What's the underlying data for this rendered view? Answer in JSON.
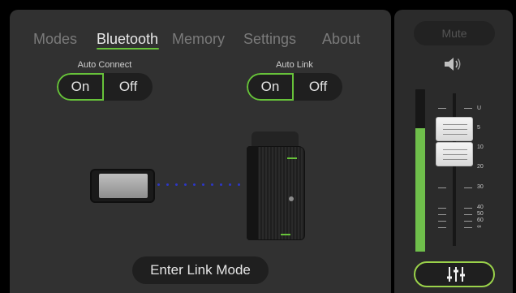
{
  "tabs": [
    "Modes",
    "Bluetooth",
    "Memory",
    "Settings",
    "About"
  ],
  "active_tab": "Bluetooth",
  "auto_connect": {
    "title": "Auto Connect",
    "on_label": "On",
    "off_label": "Off",
    "value": "On"
  },
  "auto_link": {
    "title": "Auto Link",
    "on_label": "On",
    "off_label": "Off",
    "value": "On"
  },
  "link_button_label": "Enter Link Mode",
  "side": {
    "mute_label": "Mute",
    "meter_level": 0.76,
    "scale_labels": [
      "U",
      "5",
      "10",
      "20",
      "30",
      "40",
      "50",
      "60",
      "∞"
    ]
  },
  "colors": {
    "accent_green": "#67c23a",
    "meter_green": "#6fbf4b",
    "link_dots_blue": "#2d37c8"
  },
  "icons": {
    "speaker": "speaker-volume-icon",
    "eq": "eq-sliders-icon",
    "phone": "phone-illustration",
    "loudspeaker": "loudspeaker-illustration"
  }
}
